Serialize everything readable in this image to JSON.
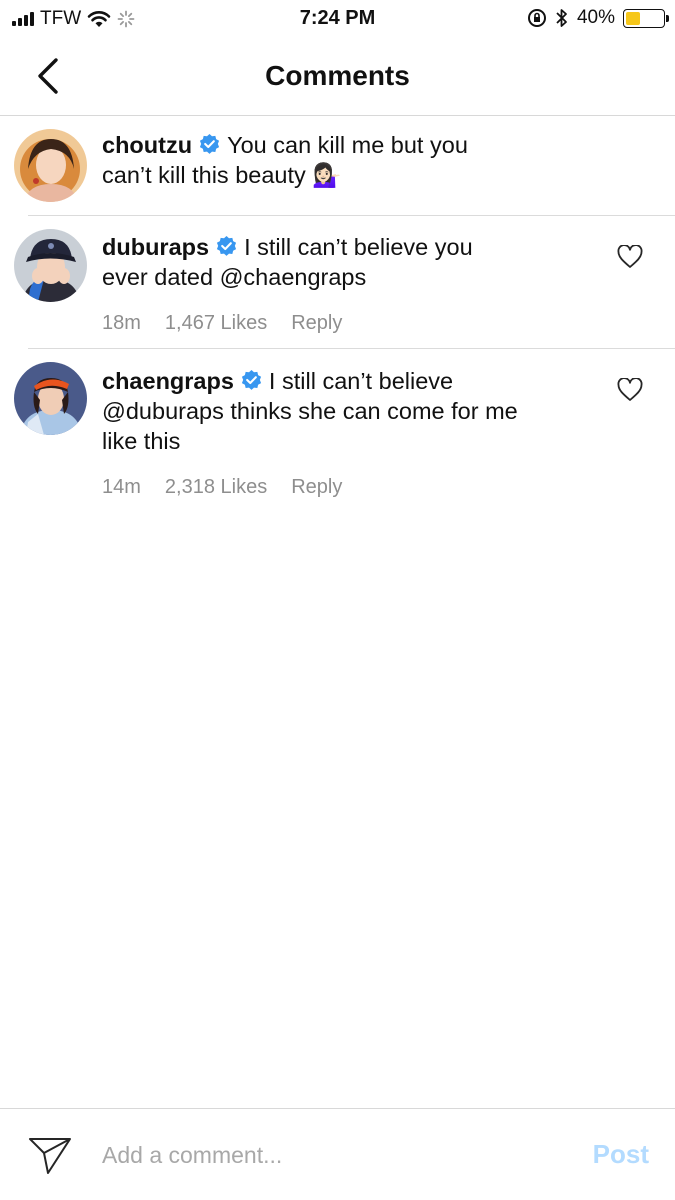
{
  "status_bar": {
    "carrier": "TFW",
    "time": "7:24 PM",
    "battery_percent": "40%",
    "battery_level": 0.4,
    "battery_color": "#f6c71a",
    "icons": [
      "signal-icon",
      "wifi-icon",
      "loading-icon",
      "rotation-lock-icon",
      "bluetooth-icon",
      "battery-icon"
    ]
  },
  "header": {
    "title": "Comments",
    "back_icon": "chevron-left-icon"
  },
  "comments": [
    {
      "username": "choutzu",
      "verified": true,
      "text": "You can kill me but you can’t kill this beauty 💁🏻‍♀️",
      "time": "",
      "likes": "",
      "reply_label": ""
    },
    {
      "username": "duburaps",
      "verified": true,
      "text": "I still can’t believe you ever dated @chaengraps",
      "time": "18m",
      "likes": "1,467 Likes",
      "reply_label": "Reply"
    },
    {
      "username": "chaengraps",
      "verified": true,
      "text": "I still can’t believe @duburaps thinks she can come for me like this",
      "time": "14m",
      "likes": "2,318 Likes",
      "reply_label": "Reply"
    }
  ],
  "composer": {
    "placeholder": "Add a comment...",
    "post_label": "Post",
    "post_color": "#b3dbff"
  },
  "colors": {
    "verified_badge": "#3897f0",
    "meta_text": "#8e8e8e"
  }
}
